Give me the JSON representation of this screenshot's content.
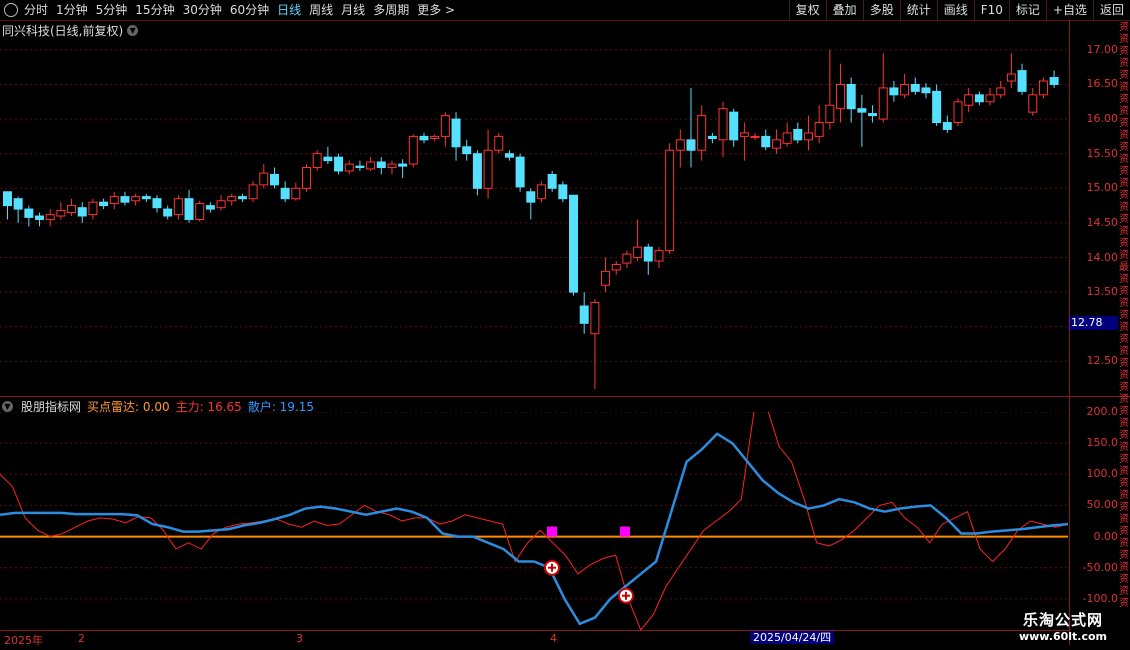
{
  "toolbar": {
    "periods": [
      "分时",
      "1分钟",
      "5分钟",
      "15分钟",
      "30分钟",
      "60分钟",
      "日线",
      "周线",
      "月线",
      "多周期",
      "更多 >"
    ],
    "active": "日线",
    "right_buttons": [
      "复权",
      "叠加",
      "多股",
      "统计",
      "画线",
      "F10",
      "标记",
      "+自选",
      "返回"
    ]
  },
  "main_title": "同兴科技(日线,前复权)",
  "price_axis": [
    "17.00",
    "16.50",
    "16.00",
    "15.50",
    "15.00",
    "14.50",
    "14.00",
    "13.50",
    "13.00",
    "12.50"
  ],
  "current_price": "12.78",
  "indicator": {
    "name": "股朋指标网",
    "buy_label": "买点雷达: 0.00",
    "main_label": "主力: 16.65",
    "retail_label": "散户: 19.15"
  },
  "indicator_axis": [
    "200.0",
    "150.0",
    "100.0",
    "50.00",
    "0.00",
    "-50.00",
    "-100.0"
  ],
  "date_axis": [
    "2025年",
    "2",
    "3",
    "4"
  ],
  "cursor_date": "2025/04/24/四",
  "watermark": {
    "line1": "乐淘公式网",
    "line2": "www.60lt.com"
  },
  "side_text": "资资资资资资资资资资资资资资资资资资资资最资资资资资资资资资资资资资资资资资资资资资资资资资资资资",
  "colors": {
    "up": "#ff3333",
    "down": "#55e0ff",
    "main_line": "#ff2222",
    "retail_line": "#2a8de0",
    "zero_line": "#ff8c00"
  },
  "chart_data": {
    "type": "candlestick",
    "ylim": [
      12.0,
      17.2
    ],
    "candles": [
      [
        14.95,
        14.75,
        14.9,
        14.55
      ],
      [
        14.85,
        14.7,
        14.88,
        14.5
      ],
      [
        14.7,
        14.58,
        14.75,
        14.45
      ],
      [
        14.6,
        14.55,
        14.65,
        14.45
      ],
      [
        14.55,
        14.62,
        14.7,
        14.45
      ],
      [
        14.6,
        14.68,
        14.8,
        14.55
      ],
      [
        14.65,
        14.75,
        14.85,
        14.6
      ],
      [
        14.72,
        14.6,
        14.8,
        14.5
      ],
      [
        14.62,
        14.8,
        14.85,
        14.55
      ],
      [
        14.8,
        14.75,
        14.85,
        14.7
      ],
      [
        14.78,
        14.88,
        14.95,
        14.7
      ],
      [
        14.88,
        14.8,
        14.95,
        14.75
      ],
      [
        14.82,
        14.88,
        14.92,
        14.75
      ],
      [
        14.88,
        14.85,
        14.92,
        14.8
      ],
      [
        14.85,
        14.72,
        14.9,
        14.65
      ],
      [
        14.7,
        14.6,
        14.75,
        14.55
      ],
      [
        14.62,
        14.85,
        14.9,
        14.55
      ],
      [
        14.85,
        14.55,
        14.98,
        14.5
      ],
      [
        14.55,
        14.78,
        14.82,
        14.52
      ],
      [
        14.75,
        14.7,
        14.8,
        14.65
      ],
      [
        14.72,
        14.82,
        14.9,
        14.68
      ],
      [
        14.82,
        14.88,
        14.92,
        14.75
      ],
      [
        14.88,
        14.85,
        14.92,
        14.8
      ],
      [
        14.85,
        15.05,
        15.1,
        14.8
      ],
      [
        15.05,
        15.22,
        15.35,
        15.0
      ],
      [
        15.2,
        15.05,
        15.3,
        15.0
      ],
      [
        15.0,
        14.85,
        15.1,
        14.8
      ],
      [
        14.85,
        15.0,
        15.08,
        14.82
      ],
      [
        15.0,
        15.3,
        15.35,
        14.95
      ],
      [
        15.3,
        15.5,
        15.55,
        15.25
      ],
      [
        15.45,
        15.4,
        15.6,
        15.35
      ],
      [
        15.45,
        15.25,
        15.5,
        15.2
      ],
      [
        15.25,
        15.35,
        15.4,
        15.2
      ],
      [
        15.32,
        15.3,
        15.4,
        15.25
      ],
      [
        15.28,
        15.38,
        15.45,
        15.25
      ],
      [
        15.38,
        15.3,
        15.45,
        15.2
      ],
      [
        15.3,
        15.35,
        15.4,
        15.2
      ],
      [
        15.35,
        15.32,
        15.42,
        15.15
      ],
      [
        15.35,
        15.75,
        15.78,
        15.3
      ],
      [
        15.75,
        15.7,
        15.8,
        15.65
      ],
      [
        15.72,
        15.75,
        15.78,
        15.68
      ],
      [
        15.75,
        16.05,
        16.1,
        15.6
      ],
      [
        16.0,
        15.6,
        16.1,
        15.4
      ],
      [
        15.6,
        15.5,
        15.7,
        15.4
      ],
      [
        15.5,
        15.0,
        15.55,
        14.9
      ],
      [
        15.0,
        15.55,
        15.85,
        14.85
      ],
      [
        15.55,
        15.75,
        15.8,
        15.5
      ],
      [
        15.5,
        15.45,
        15.55,
        15.4
      ],
      [
        15.45,
        15.02,
        15.5,
        14.95
      ],
      [
        14.95,
        14.8,
        15.0,
        14.55
      ],
      [
        14.85,
        15.05,
        15.1,
        14.8
      ],
      [
        15.2,
        15.0,
        15.25,
        14.95
      ],
      [
        15.05,
        14.85,
        15.1,
        14.8
      ],
      [
        14.9,
        13.5,
        14.9,
        13.45
      ],
      [
        13.3,
        13.05,
        13.5,
        12.9
      ],
      [
        12.9,
        13.35,
        13.4,
        12.1
      ],
      [
        13.6,
        13.8,
        14.0,
        13.5
      ],
      [
        13.82,
        13.9,
        13.95,
        13.75
      ],
      [
        13.92,
        14.05,
        14.1,
        13.85
      ],
      [
        14.0,
        14.15,
        14.55,
        13.95
      ],
      [
        14.15,
        13.95,
        14.2,
        13.75
      ],
      [
        13.95,
        14.1,
        14.15,
        13.85
      ],
      [
        14.1,
        15.55,
        15.65,
        14.05
      ],
      [
        15.55,
        15.7,
        15.85,
        15.3
      ],
      [
        15.7,
        15.55,
        16.45,
        15.3
      ],
      [
        15.55,
        16.05,
        16.2,
        15.4
      ],
      [
        15.75,
        15.72,
        15.8,
        15.65
      ],
      [
        15.7,
        16.15,
        16.25,
        15.45
      ],
      [
        16.1,
        15.7,
        16.15,
        15.6
      ],
      [
        15.75,
        15.8,
        15.95,
        15.4
      ],
      [
        15.75,
        15.75,
        15.8,
        15.7
      ],
      [
        15.75,
        15.6,
        15.85,
        15.55
      ],
      [
        15.58,
        15.7,
        15.85,
        15.5
      ],
      [
        15.65,
        15.8,
        15.95,
        15.6
      ],
      [
        15.85,
        15.7,
        15.95,
        15.65
      ],
      [
        15.7,
        15.8,
        16.05,
        15.55
      ],
      [
        15.75,
        15.95,
        16.2,
        15.65
      ],
      [
        15.95,
        16.2,
        17.0,
        15.85
      ],
      [
        16.15,
        16.5,
        16.8,
        15.95
      ],
      [
        16.5,
        16.15,
        16.6,
        15.95
      ],
      [
        16.15,
        16.1,
        16.35,
        15.6
      ],
      [
        16.08,
        16.05,
        16.2,
        15.95
      ],
      [
        16.0,
        16.45,
        16.95,
        15.95
      ],
      [
        16.45,
        16.35,
        16.55,
        16.25
      ],
      [
        16.35,
        16.5,
        16.65,
        16.3
      ],
      [
        16.5,
        16.4,
        16.6,
        16.35
      ],
      [
        16.45,
        16.38,
        16.52,
        16.3
      ],
      [
        16.4,
        15.95,
        16.5,
        15.9
      ],
      [
        15.95,
        15.85,
        16.05,
        15.8
      ],
      [
        15.95,
        16.25,
        16.3,
        15.9
      ],
      [
        16.2,
        16.35,
        16.45,
        16.1
      ],
      [
        16.35,
        16.25,
        16.4,
        16.2
      ],
      [
        16.25,
        16.35,
        16.45,
        16.2
      ],
      [
        16.35,
        16.45,
        16.55,
        16.3
      ],
      [
        16.55,
        16.65,
        16.95,
        16.45
      ],
      [
        16.7,
        16.4,
        16.8,
        16.35
      ],
      [
        16.1,
        16.35,
        16.45,
        16.05
      ],
      [
        16.35,
        16.55,
        16.6,
        16.3
      ],
      [
        16.6,
        16.5,
        16.7,
        16.45
      ]
    ],
    "indicator_ylim": [
      -150,
      200
    ],
    "main_force": [
      100,
      80,
      30,
      10,
      0,
      5,
      15,
      25,
      30,
      28,
      22,
      32,
      30,
      10,
      -20,
      -10,
      -20,
      5,
      15,
      20,
      22,
      25,
      28,
      20,
      15,
      25,
      18,
      20,
      35,
      50,
      40,
      35,
      25,
      30,
      30,
      20,
      25,
      35,
      30,
      25,
      20,
      -40,
      -10,
      10,
      -10,
      -30,
      -60,
      -45,
      -35,
      -30,
      -100,
      -150,
      -125,
      -80,
      -50,
      -20,
      10,
      25,
      40,
      60,
      200,
      210,
      145,
      120,
      60,
      -10,
      -15,
      -5,
      10,
      30,
      50,
      55,
      30,
      15,
      -10,
      20,
      30,
      40,
      -20,
      -40,
      -20,
      10,
      25,
      20,
      15,
      20
    ]
  }
}
